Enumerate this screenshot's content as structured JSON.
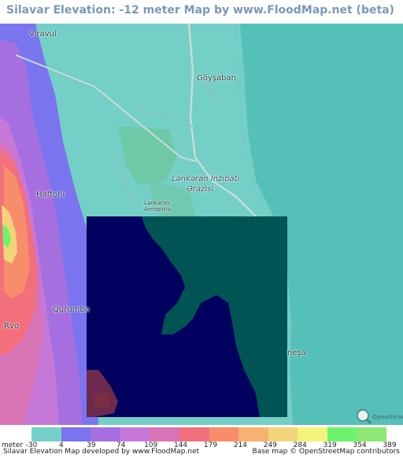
{
  "title": "Silavar Elevation: -12 meter Map by www.FloodMap.net (beta)",
  "places": {
    "viravul": "Viravul",
    "goysaban": "Göyşaban",
    "haftoni": "Haftoni",
    "qurumba": "Qurumba",
    "rvo": "Rvo",
    "nesa": "neşa",
    "lankaran_district_1": "Lənkəran İnzibati",
    "lankaran_district_2": "Ərazisi",
    "airport_1": "Lənkəran",
    "airport_2": "Aeroportu"
  },
  "osm_logo_text": "OpenStreetMap",
  "legend": {
    "unit_label": "meter",
    "colors": [
      "#76d1c9",
      "#7b74ef",
      "#a56fe0",
      "#c678d9",
      "#d873b5",
      "#f2707c",
      "#f78d6b",
      "#f7b270",
      "#f2d57a",
      "#f4f47a",
      "#6ef36c",
      "#8ee876"
    ],
    "ticks": [
      "-30",
      "4",
      "39",
      "74",
      "109",
      "144",
      "179",
      "214",
      "249",
      "284",
      "319",
      "354",
      "389"
    ]
  },
  "footer": {
    "left": "Silavar Elevation Map developed by www.FloodMap.net",
    "right": "Base map © OpenStreetMap contributors"
  }
}
